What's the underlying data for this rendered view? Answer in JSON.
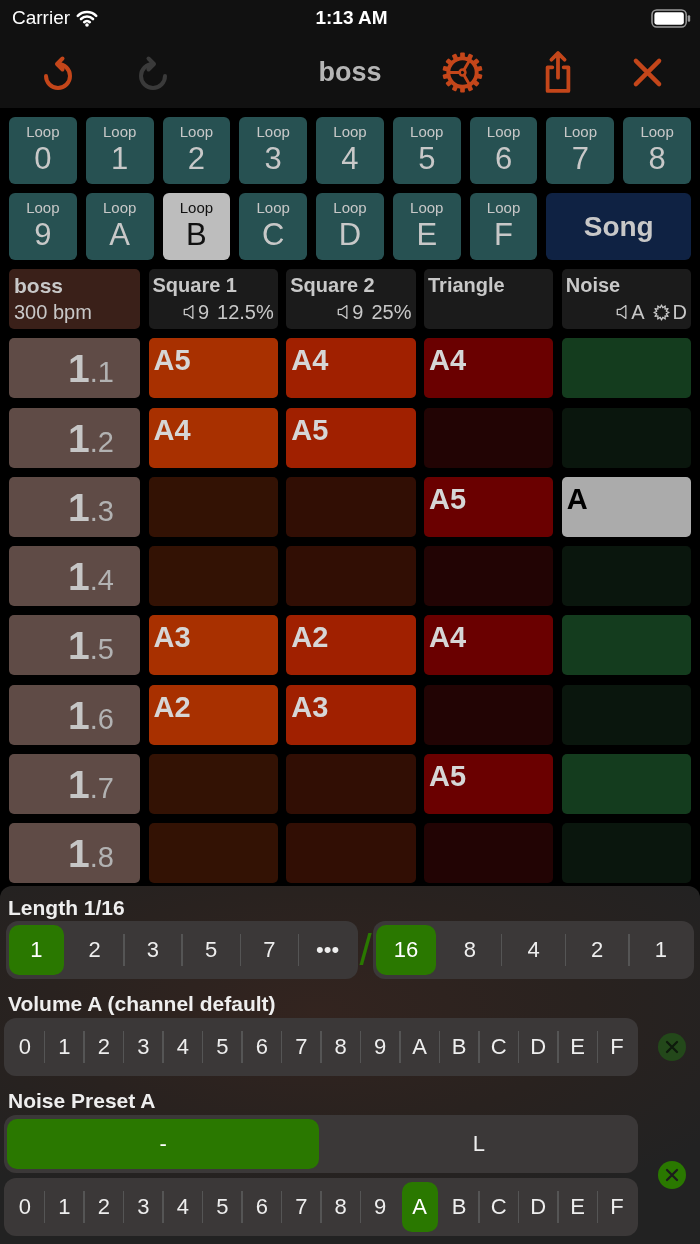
{
  "status_bar": {
    "carrier": "Carrier",
    "time": "1:13 AM"
  },
  "toolbar": {
    "title": "boss",
    "left_buttons": [
      {
        "kind": "undo",
        "disabled": false
      },
      {
        "kind": "redo",
        "disabled": true
      }
    ],
    "right_buttons": [
      {
        "kind": "settings",
        "disabled": false
      },
      {
        "kind": "share",
        "disabled": false
      },
      {
        "kind": "close",
        "disabled": false
      }
    ]
  },
  "loops": [
    {
      "caption": "Loop",
      "symbol": "0",
      "selected": false
    },
    {
      "caption": "Loop",
      "symbol": "1",
      "selected": false
    },
    {
      "caption": "Loop",
      "symbol": "2",
      "selected": false
    },
    {
      "caption": "Loop",
      "symbol": "3",
      "selected": false
    },
    {
      "caption": "Loop",
      "symbol": "4",
      "selected": false
    },
    {
      "caption": "Loop",
      "symbol": "5",
      "selected": false
    },
    {
      "caption": "Loop",
      "symbol": "6",
      "selected": false
    },
    {
      "caption": "Loop",
      "symbol": "7",
      "selected": false
    },
    {
      "caption": "Loop",
      "symbol": "8",
      "selected": false
    },
    {
      "caption": "Loop",
      "symbol": "9",
      "selected": false
    },
    {
      "caption": "Loop",
      "symbol": "A",
      "selected": false
    },
    {
      "caption": "Loop",
      "symbol": "B",
      "selected": true
    },
    {
      "caption": "Loop",
      "symbol": "C",
      "selected": false
    },
    {
      "caption": "Loop",
      "symbol": "D",
      "selected": false
    },
    {
      "caption": "Loop",
      "symbol": "E",
      "selected": false
    },
    {
      "caption": "Loop",
      "symbol": "F",
      "selected": false
    }
  ],
  "song_button": {
    "label": "Song",
    "selected": false
  },
  "song_header": {
    "title": "boss",
    "tempo": "300 bpm"
  },
  "channels": [
    {
      "name": "Square 1",
      "color": "#a83000",
      "volume": "9",
      "duty": "12.5%"
    },
    {
      "name": "Square 2",
      "color": "#a02000",
      "volume": "9",
      "duty": "25%"
    },
    {
      "name": "Triangle",
      "color": "#6a0000"
    },
    {
      "name": "Noise",
      "color": "#143c1e",
      "volume": "A",
      "preset": "D"
    }
  ],
  "rows": [
    {
      "bar": "1",
      "step": ".1",
      "cells": [
        {
          "note": "A5",
          "filled": true,
          "selected": false
        },
        {
          "note": "A4",
          "filled": true,
          "selected": false
        },
        {
          "note": "A4",
          "filled": true,
          "selected": false
        },
        {
          "filled": true,
          "selected": false
        }
      ]
    },
    {
      "bar": "1",
      "step": ".2",
      "cells": [
        {
          "note": "A4",
          "filled": true,
          "selected": false
        },
        {
          "note": "A5",
          "filled": true,
          "selected": false
        },
        {
          "filled": false,
          "selected": false
        },
        {
          "filled": false,
          "selected": false
        }
      ]
    },
    {
      "bar": "1",
      "step": ".3",
      "cells": [
        {
          "filled": false,
          "selected": false
        },
        {
          "filled": false,
          "selected": false
        },
        {
          "note": "A5",
          "filled": true,
          "selected": false
        },
        {
          "note": "A",
          "filled": true,
          "selected": true
        }
      ]
    },
    {
      "bar": "1",
      "step": ".4",
      "cells": [
        {
          "filled": false,
          "selected": false
        },
        {
          "filled": false,
          "selected": false
        },
        {
          "filled": false,
          "selected": false
        },
        {
          "filled": false,
          "selected": false
        }
      ]
    },
    {
      "bar": "1",
      "step": ".5",
      "cells": [
        {
          "note": "A3",
          "filled": true,
          "selected": false
        },
        {
          "note": "A2",
          "filled": true,
          "selected": false
        },
        {
          "note": "A4",
          "filled": true,
          "selected": false
        },
        {
          "filled": true,
          "selected": false
        }
      ]
    },
    {
      "bar": "1",
      "step": ".6",
      "cells": [
        {
          "note": "A2",
          "filled": true,
          "selected": false
        },
        {
          "note": "A3",
          "filled": true,
          "selected": false
        },
        {
          "filled": false,
          "selected": false
        },
        {
          "filled": false,
          "selected": false
        }
      ]
    },
    {
      "bar": "1",
      "step": ".7",
      "cells": [
        {
          "filled": false,
          "selected": false
        },
        {
          "filled": false,
          "selected": false
        },
        {
          "note": "A5",
          "filled": true,
          "selected": false
        },
        {
          "filled": true,
          "selected": false
        }
      ]
    },
    {
      "bar": "1",
      "step": ".8",
      "cells": [
        {
          "filled": false,
          "selected": false
        },
        {
          "filled": false,
          "selected": false
        },
        {
          "filled": false,
          "selected": false
        },
        {
          "filled": false,
          "selected": false
        }
      ]
    }
  ],
  "editor": {
    "sections": [
      {
        "kind": "fraction",
        "label": "Length 1/16",
        "numerator": [
          {
            "text": "1",
            "selected": true
          },
          {
            "text": "2",
            "selected": false
          },
          {
            "text": "3",
            "selected": false
          },
          {
            "text": "5",
            "selected": false
          },
          {
            "text": "7",
            "selected": false
          },
          {
            "text": "•••",
            "selected": false
          }
        ],
        "separator": "/",
        "denominator": [
          {
            "text": "16",
            "selected": true
          },
          {
            "text": "8",
            "selected": false
          },
          {
            "text": "4",
            "selected": false
          },
          {
            "text": "2",
            "selected": false
          },
          {
            "text": "1",
            "selected": false
          }
        ]
      },
      {
        "kind": "picker",
        "label": "Volume A (channel default)",
        "groups": [
          {
            "options": [
              {
                "text": "0",
                "selected": false
              },
              {
                "text": "1",
                "selected": false
              },
              {
                "text": "2",
                "selected": false
              },
              {
                "text": "3",
                "selected": false
              },
              {
                "text": "4",
                "selected": false
              },
              {
                "text": "5",
                "selected": false
              },
              {
                "text": "6",
                "selected": false
              },
              {
                "text": "7",
                "selected": false
              },
              {
                "text": "8",
                "selected": false
              },
              {
                "text": "9",
                "selected": false
              },
              {
                "text": "A",
                "selected": false
              },
              {
                "text": "B",
                "selected": false
              },
              {
                "text": "C",
                "selected": false
              },
              {
                "text": "D",
                "selected": false
              },
              {
                "text": "E",
                "selected": false
              },
              {
                "text": "F",
                "selected": false
              }
            ]
          }
        ],
        "clear": {
          "disabled": true
        }
      },
      {
        "kind": "picker",
        "label": "Noise Preset A",
        "groups": [
          {
            "options": [
              {
                "text": "-",
                "selected": true
              },
              {
                "text": "L",
                "selected": false
              }
            ]
          },
          {
            "options": [
              {
                "text": "0",
                "selected": false
              },
              {
                "text": "1",
                "selected": false
              },
              {
                "text": "2",
                "selected": false
              },
              {
                "text": "3",
                "selected": false
              },
              {
                "text": "4",
                "selected": false
              },
              {
                "text": "5",
                "selected": false
              },
              {
                "text": "6",
                "selected": false
              },
              {
                "text": "7",
                "selected": false
              },
              {
                "text": "8",
                "selected": false
              },
              {
                "text": "9",
                "selected": false
              },
              {
                "text": "A",
                "selected": true
              },
              {
                "text": "B",
                "selected": false
              },
              {
                "text": "C",
                "selected": false
              },
              {
                "text": "D",
                "selected": false
              },
              {
                "text": "E",
                "selected": false
              },
              {
                "text": "F",
                "selected": false
              }
            ]
          }
        ],
        "clear": {
          "disabled": false
        }
      }
    ]
  }
}
